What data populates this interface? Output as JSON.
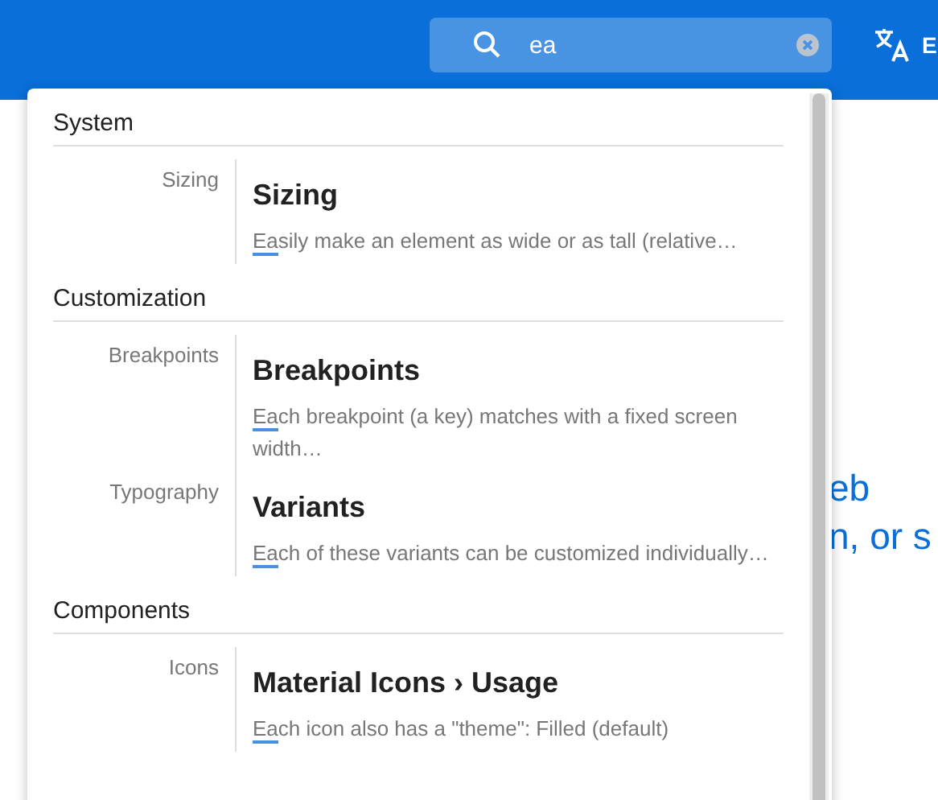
{
  "search": {
    "value": "ea"
  },
  "header": {
    "language_label": "E"
  },
  "background_text": [
    "eb",
    "n, or s"
  ],
  "results": [
    {
      "section": "System",
      "items": [
        {
          "category": "Sizing",
          "title": "Sizing",
          "description": {
            "match": "Ea",
            "rest": "sily make an element as wide or as tall (relative…"
          }
        }
      ]
    },
    {
      "section": "Customization",
      "items": [
        {
          "category": "Breakpoints",
          "title": "Breakpoints",
          "description": {
            "match": "Ea",
            "rest": "ch breakpoint (a key) matches with a fixed screen width…"
          }
        },
        {
          "category": "Typography",
          "title": "Variants",
          "description": {
            "match": "Ea",
            "rest": "ch of these variants can be customized individually…"
          }
        }
      ]
    },
    {
      "section": "Components",
      "items": [
        {
          "category": "Icons",
          "title": "Material Icons › Usage",
          "description": {
            "match": "Ea",
            "rest": "ch icon also has a \"theme\": Filled (default)"
          }
        }
      ]
    }
  ]
}
